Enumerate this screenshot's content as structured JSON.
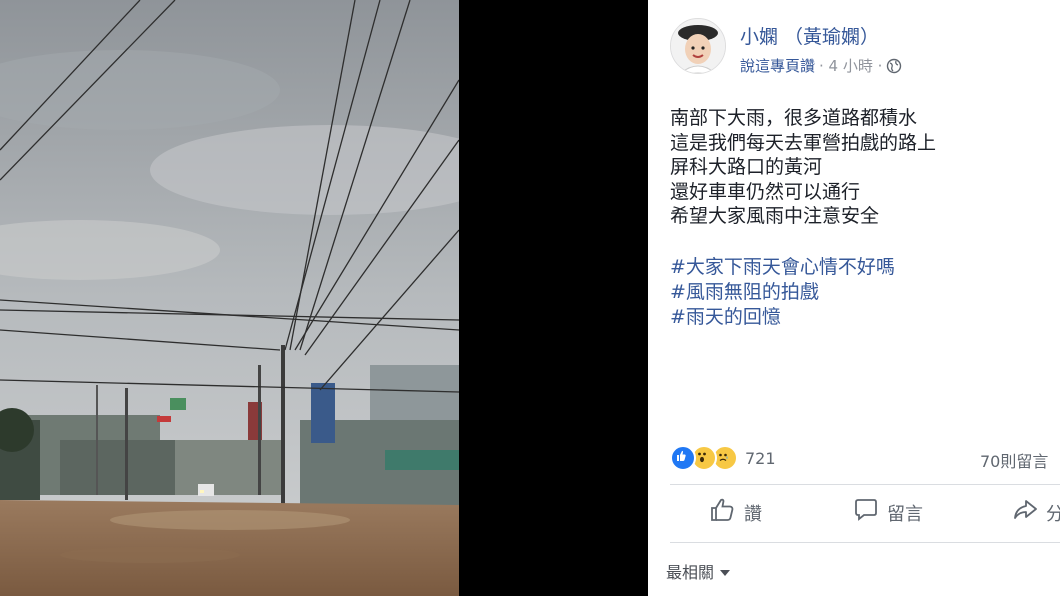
{
  "post": {
    "author": "小嫻 （黃瑜嫻）",
    "meta_link": "說這專頁讚",
    "meta_time": "· 4 小時 ·",
    "privacy_icon": "globe-icon",
    "body_lines": [
      "南部下大雨，很多道路都積水",
      "這是我們每天去軍營拍戲的路上",
      "屏科大路口的黃河",
      "還好車車仍然可以通行",
      "希望大家風雨中注意安全"
    ],
    "hashtags": [
      "#大家下雨天會心情不好嗎",
      "#風雨無阻的拍戲",
      "#雨天的回憶"
    ],
    "reactions": {
      "icons": [
        "like-icon",
        "wow-icon",
        "sad-icon"
      ],
      "count": "721"
    },
    "comments_count": "70則留言",
    "actions": {
      "like": "讚",
      "comment": "留言",
      "share": "分享"
    },
    "sort_label": "最相關"
  },
  "colors": {
    "link": "#365899",
    "muted": "#90949c",
    "text": "#1d2129",
    "like_blue": "#2078f4",
    "reaction_yellow": "#f7c844"
  }
}
